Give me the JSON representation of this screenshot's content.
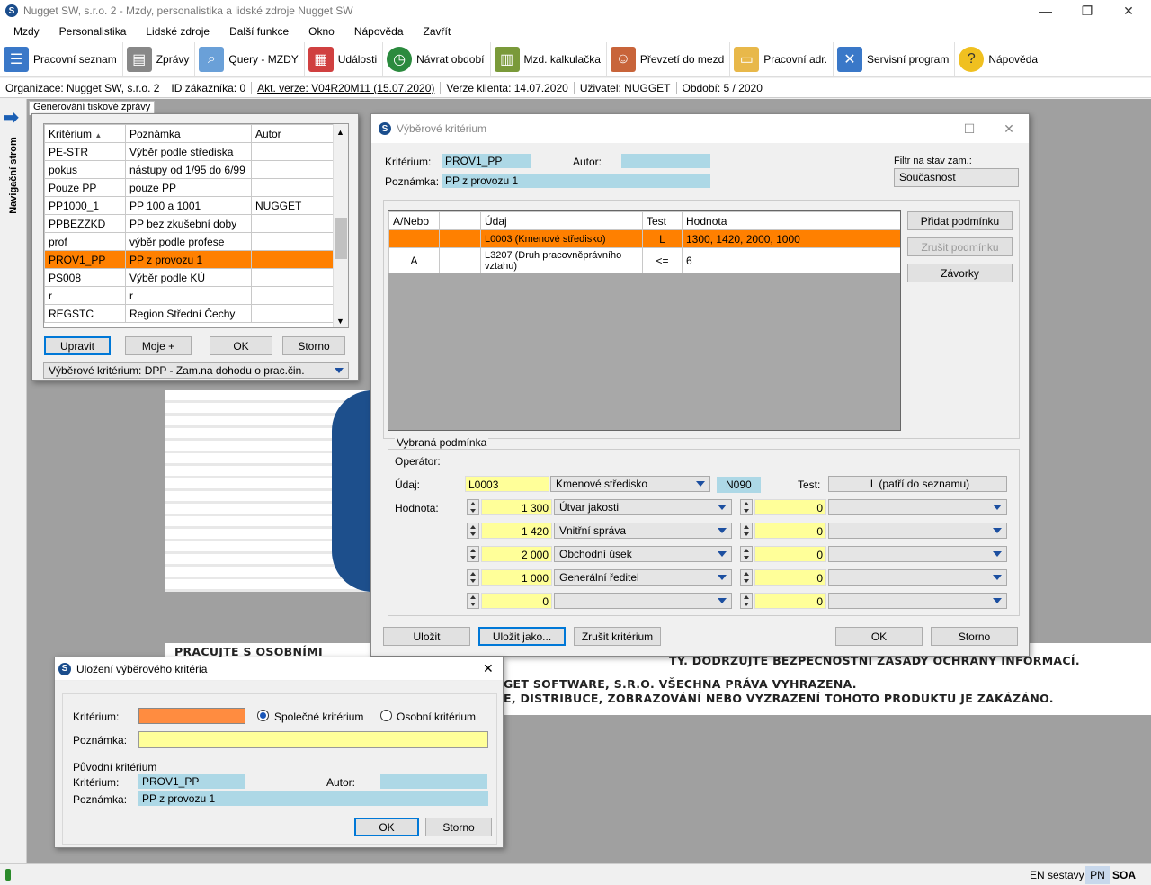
{
  "app": {
    "title": "Nugget SW, s.r.o. 2 - Mzdy, personalistika a lidské zdroje Nugget SW",
    "icon_letter": "S"
  },
  "window_controls": {
    "minimize": "—",
    "restore": "❐",
    "close": "✕"
  },
  "menu": [
    "Mzdy",
    "Personalistika",
    "Lidské zdroje",
    "Další funkce",
    "Okno",
    "Nápověda",
    "Zavřít"
  ],
  "toolbar": [
    {
      "label": "Pracovní seznam",
      "icon": "list-icon",
      "color": "#3a78c8"
    },
    {
      "label": "Zprávy",
      "icon": "printer-icon",
      "color": "#777"
    },
    {
      "label": "Query - MZDY",
      "icon": "magnifier-icon",
      "color": "#6aa0d8"
    },
    {
      "label": "Události",
      "icon": "calendar-icon",
      "color": "#d04040"
    },
    {
      "label": "Návrat období",
      "icon": "clock-icon",
      "color": "#2b8a3e"
    },
    {
      "label": "Mzd. kalkulačka",
      "icon": "calculator-icon",
      "color": "#7a9a3a"
    },
    {
      "label": "Převzetí do mezd",
      "icon": "users-icon",
      "color": "#c8643a"
    },
    {
      "label": "Pracovní adr.",
      "icon": "folder-icon",
      "color": "#e8b84a"
    },
    {
      "label": "Servisní program",
      "icon": "tools-icon",
      "color": "#3a78c8"
    },
    {
      "label": "Nápověda",
      "icon": "help-icon",
      "color": "#f0c020"
    }
  ],
  "infobar": {
    "org": "Organizace: Nugget SW, s.r.o. 2",
    "customer": "ID zákazníka: 0",
    "version": "Akt. verze: V04R20M11 (15.07.2020)",
    "client": "Verze klienta: 14.07.2020",
    "user": "Uživatel: NUGGET",
    "period": "Období: 5 / 2020"
  },
  "nav": {
    "label": "Navigační strom"
  },
  "tab": {
    "label": "Generování tiskové zprávy"
  },
  "criteria_list": {
    "headers": [
      "Kritérium",
      "Poznámka",
      "Autor"
    ],
    "rows": [
      [
        "PE-STR",
        "Výběr podle střediska",
        ""
      ],
      [
        "pokus",
        "nástupy od 1/95 do 6/99",
        ""
      ],
      [
        "Pouze PP",
        "pouze PP",
        ""
      ],
      [
        "PP1000_1",
        "PP 100 a 1001",
        "NUGGET"
      ],
      [
        "PPBEZZKD",
        "PP bez zkušební doby",
        ""
      ],
      [
        "prof",
        "výběr podle profese",
        ""
      ],
      [
        "PROV1_PP",
        "PP z provozu 1",
        ""
      ],
      [
        "PS008",
        "Výběr podle KÚ",
        ""
      ],
      [
        "r",
        "r",
        ""
      ],
      [
        "REGSTC",
        "Region Střední Čechy",
        ""
      ]
    ],
    "selected_index": 6,
    "buttons": {
      "edit": "Upravit",
      "mine": "Moje +",
      "ok": "OK",
      "cancel": "Storno"
    },
    "selector": "Výběrové kritérium: DPP - Zam.na dohodu o prac.čin."
  },
  "background": {
    "banner1": "PRACUJTE S OSOBNÍMI ... ATY. DODRŽUJTE BEZPEČNOSTNÍ ZÁSADY OCHRANY INFORMACÍ.",
    "banner1a": "PRACUJTE S OSOBNÍMI",
    "banner1b": "TY. DODRŽUJTE BEZPEČNOSTNÍ ZÁSADY OCHRANY INFORMACÍ.",
    "banner2": "GET SOFTWARE, S.R.O. VŠECHNA PRÁVA VYHRAZENA.",
    "banner3": "E, DISTRIBUCE, ZOBRAZOVÁNÍ NEBO VYZRAZENÍ TOHOTO PRODUKTU JE ZAKÁZÁNO."
  },
  "crit_window": {
    "title": "Výběrové kritérium",
    "labels": {
      "criterion": "Kritérium:",
      "author": "Autor:",
      "note": "Poznámka:",
      "filter": "Filtr na stav zam.:"
    },
    "criterion": "PROV1_PP",
    "author": "",
    "note": "PP z provozu 1",
    "filter": "Současnost",
    "cond_headers": [
      "A/Nebo",
      "",
      "Údaj",
      "Test",
      "Hodnota"
    ],
    "conditions": [
      {
        "andor": "",
        "x": "",
        "field": "L0003 (Kmenové středisko)",
        "test": "L",
        "value": "1300, 1420, 2000, 1000"
      },
      {
        "andor": "A",
        "x": "",
        "field": "L3207 (Druh pracovněprávního vztahu)",
        "test": "<=",
        "value": "6"
      }
    ],
    "side_buttons": {
      "add": "Přidat podmínku",
      "remove": "Zrušit podmínku",
      "brackets": "Závorky"
    },
    "selected_cond": {
      "group": "Vybraná podmínka",
      "operator_label": "Operátor:",
      "field_label": "Údaj:",
      "value_label": "Hodnota:",
      "test_label": "Test:",
      "field_code": "L0003",
      "field_name": "Kmenové středisko",
      "code": "N090",
      "test": "L  (patří do seznamu)",
      "values": [
        {
          "num": "1 300",
          "name": "Útvar jakosti",
          "num2": "0",
          "name2": ""
        },
        {
          "num": "1 420",
          "name": "Vnitřní správa",
          "num2": "0",
          "name2": ""
        },
        {
          "num": "2 000",
          "name": "Obchodní úsek",
          "num2": "0",
          "name2": ""
        },
        {
          "num": "1 000",
          "name": "Generální ředitel",
          "num2": "0",
          "name2": ""
        },
        {
          "num": "0",
          "name": "",
          "num2": "0",
          "name2": ""
        }
      ]
    },
    "buttons": {
      "save": "Uložit",
      "save_as": "Uložit jako...",
      "cancel_crit": "Zrušit kritérium",
      "ok": "OK",
      "cancel": "Storno"
    }
  },
  "save_window": {
    "title": "Uložení výběrového kritéria",
    "labels": {
      "criterion": "Kritérium:",
      "note": "Poznámka:",
      "shared": "Společné kritérium",
      "personal": "Osobní kritérium",
      "orig": "Původní kritérium",
      "orig_criterion": "Kritérium:",
      "author": "Autor:",
      "orig_note": "Poznámka:"
    },
    "criterion": "",
    "note": "",
    "orig_criterion": "PROV1_PP",
    "orig_author": "",
    "orig_note": "PP z provozu 1",
    "buttons": {
      "ok": "OK",
      "cancel": "Storno"
    }
  },
  "status": {
    "left": "",
    "en": "EN sestavy",
    "pn": "PN",
    "soa": "SOA"
  }
}
